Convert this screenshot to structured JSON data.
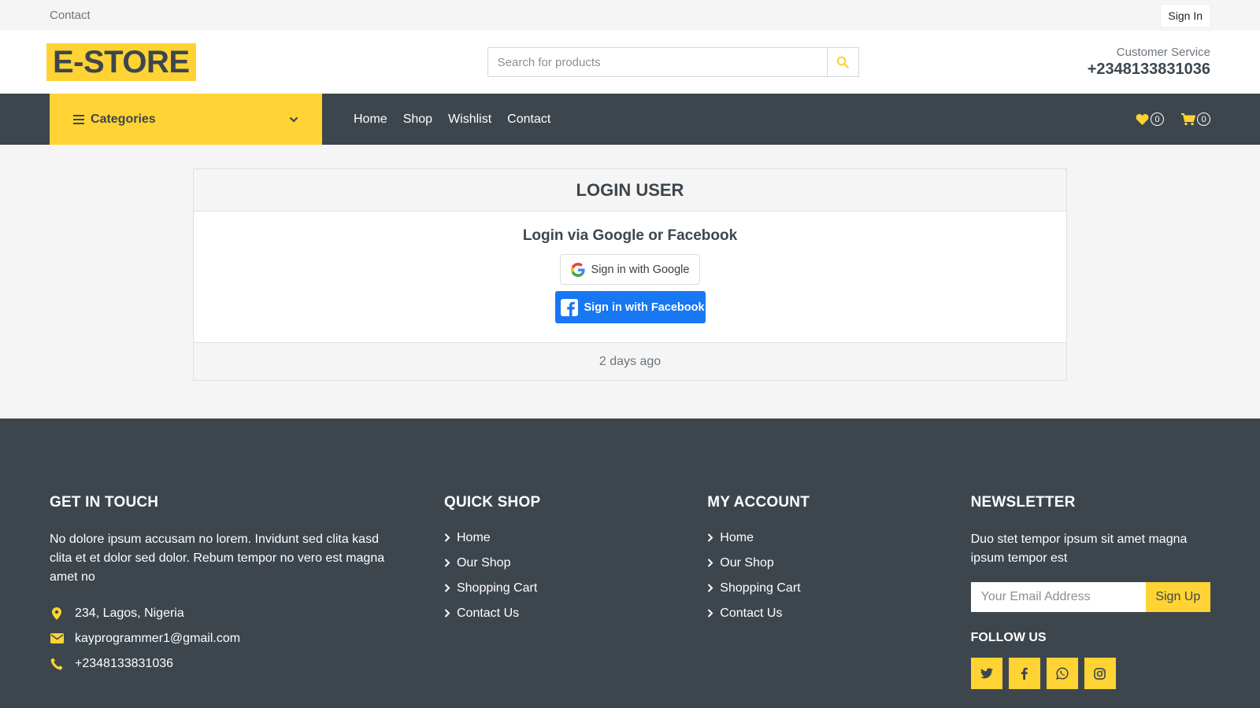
{
  "topbar": {
    "contact": "Contact",
    "signin": "Sign In"
  },
  "header": {
    "logo": "E-STORE",
    "search_placeholder": "Search for products",
    "cs_label": "Customer Service",
    "cs_phone": "+2348133831036"
  },
  "navbar": {
    "categories": "Categories",
    "links": [
      "Home",
      "Shop",
      "Wishlist",
      "Contact"
    ],
    "wishlist_count": "0",
    "cart_count": "0"
  },
  "login": {
    "title": "LOGIN USER",
    "subtitle": "Login via Google or Facebook",
    "google": "Sign in with Google",
    "facebook": "Sign in with Facebook",
    "footer_time": "2 days ago"
  },
  "footer": {
    "touch": {
      "title": "GET IN TOUCH",
      "about": "No dolore ipsum accusam no lorem. Invidunt sed clita kasd clita et et dolor sed dolor. Rebum tempor no vero est magna amet no",
      "address": "234, Lagos, Nigeria",
      "email": "kayprogrammer1@gmail.com",
      "phone": "+2348133831036"
    },
    "quick_shop": {
      "title": "QUICK SHOP",
      "links": [
        "Home",
        "Our Shop",
        "Shopping Cart",
        "Contact Us"
      ]
    },
    "my_account": {
      "title": "MY ACCOUNT",
      "links": [
        "Home",
        "Our Shop",
        "Shopping Cart",
        "Contact Us"
      ]
    },
    "newsletter": {
      "title": "NEWSLETTER",
      "text": "Duo stet tempor ipsum sit amet magna ipsum tempor est",
      "email_placeholder": "Your Email Address",
      "signup": "Sign Up",
      "follow": "FOLLOW US"
    }
  },
  "colors": {
    "accent": "#ffd333",
    "dark": "#3d464d",
    "facebook": "#1877f2"
  },
  "icons": [
    "search-icon",
    "bars-icon",
    "chevron-down-icon",
    "heart-icon",
    "cart-icon",
    "google-icon",
    "facebook-icon",
    "map-marker-icon",
    "envelope-icon",
    "phone-icon",
    "chevron-right-icon",
    "twitter-icon",
    "whatsapp-icon",
    "instagram-icon"
  ]
}
